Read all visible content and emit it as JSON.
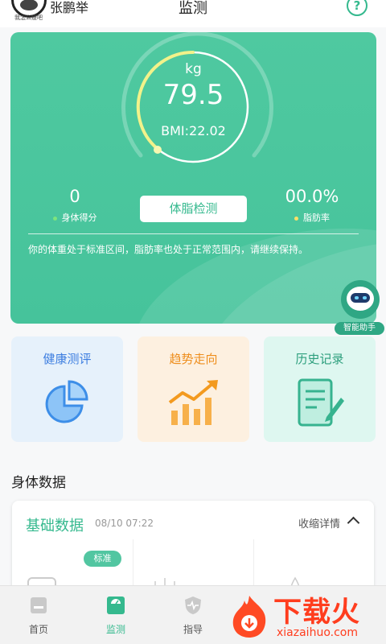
{
  "header": {
    "avatar_caption": "我怎么瘦吧",
    "user_name": "张鹏举",
    "title": "监测",
    "help_glyph": "?"
  },
  "summary": {
    "unit": "kg",
    "weight": "79.5",
    "bmi": "BMI:22.02",
    "score_value": "0",
    "score_label": "身体得分",
    "fat_value": "00.0%",
    "fat_label": "脂肪率",
    "detect_button": "体脂检测",
    "advice": "你的体重处于标准区间，脂肪率也处于正常范围内，请继续保持。",
    "score_dot_color": "#7de47d",
    "fat_dot_color": "#ffe066"
  },
  "assistant": {
    "label": "智能助手"
  },
  "tiles": [
    {
      "label": "健康测评",
      "icon": "pie-chart-icon"
    },
    {
      "label": "趋势走向",
      "icon": "trend-chart-icon"
    },
    {
      "label": "历史记录",
      "icon": "history-document-icon"
    }
  ],
  "body_data": {
    "section_title": "身体数据",
    "card_title": "基础数据",
    "timestamp": "08/10 07:22",
    "collapse_label": "收缩详情",
    "badge": "标准"
  },
  "nav": [
    {
      "label": "首页",
      "icon": "home-icon",
      "active": false
    },
    {
      "label": "监测",
      "icon": "scale-icon",
      "active": true
    },
    {
      "label": "指导",
      "icon": "shield-pulse-icon",
      "active": false
    }
  ],
  "watermark": {
    "text": "下载火",
    "sub": "xiazaihuo.com"
  },
  "colors": {
    "brand_green": "#35b98e",
    "card_green": "#4cc79e",
    "gauge_yellow": "#f2f28a"
  }
}
